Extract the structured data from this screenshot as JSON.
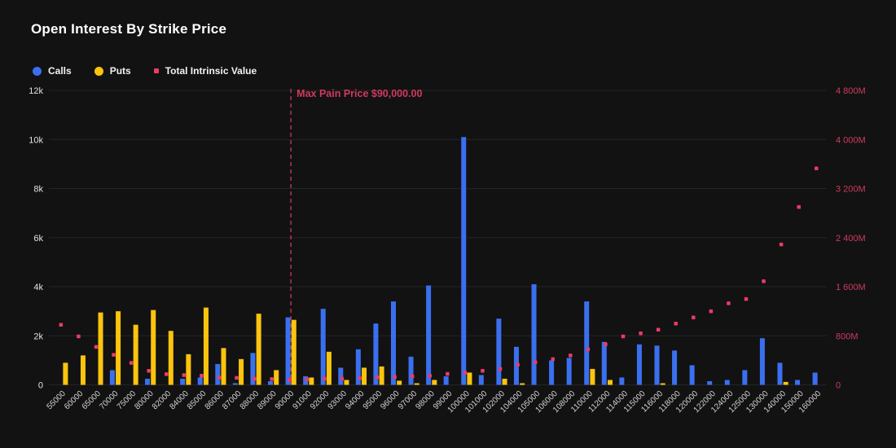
{
  "header": {
    "title": "Open Interest By Strike Price"
  },
  "legend": [
    {
      "label": "Calls",
      "color": "#3a70f0",
      "shape": "circle"
    },
    {
      "label": "Puts",
      "color": "#fcc40d",
      "shape": "circle"
    },
    {
      "label": "Total Intrinsic Value",
      "color": "#ee3a63",
      "shape": "square"
    }
  ],
  "annotation": {
    "max_pain_label": "Max Pain Price $90,000.00",
    "max_pain_strike": "90000"
  },
  "colors": {
    "background": "#121212",
    "grid": "#242428",
    "axis_text": "#e2e2e2",
    "x_text": "#cfcfcf",
    "calls": "#3a70f0",
    "puts": "#fcc40d",
    "intrinsic": "#ee3a63",
    "intrinsic_axis": "#cf3a5f",
    "max_pain_line": "#a93350"
  },
  "chart_data": {
    "type": "bar",
    "title": "Open Interest By Strike Price",
    "categories": [
      "55000",
      "60000",
      "65000",
      "70000",
      "75000",
      "80000",
      "82000",
      "84000",
      "85000",
      "86000",
      "87000",
      "88000",
      "89000",
      "90000",
      "91000",
      "92000",
      "93000",
      "94000",
      "95000",
      "96000",
      "97000",
      "98000",
      "99000",
      "100000",
      "101000",
      "102000",
      "104000",
      "105000",
      "106000",
      "108000",
      "110000",
      "112000",
      "114000",
      "115000",
      "116000",
      "118000",
      "120000",
      "122000",
      "124000",
      "125000",
      "130000",
      "140000",
      "150000",
      "160000"
    ],
    "series": [
      {
        "name": "Calls",
        "type": "bar",
        "axis": "left",
        "values": [
          0,
          0,
          0,
          600,
          0,
          250,
          0,
          250,
          300,
          850,
          70,
          1300,
          150,
          2750,
          350,
          3100,
          700,
          1450,
          2500,
          3400,
          1150,
          4050,
          350,
          10100,
          400,
          2700,
          1550,
          4100,
          1000,
          1100,
          3400,
          1750,
          300,
          1650,
          1600,
          1400,
          800,
          150,
          200,
          600,
          1900,
          900,
          200,
          500
        ]
      },
      {
        "name": "Puts",
        "type": "bar",
        "axis": "left",
        "values": [
          900,
          1200,
          2950,
          3000,
          2450,
          3050,
          2200,
          1250,
          3150,
          1500,
          1050,
          2900,
          600,
          2650,
          300,
          1350,
          200,
          700,
          750,
          170,
          60,
          200,
          0,
          500,
          0,
          250,
          60,
          0,
          0,
          0,
          650,
          200,
          0,
          0,
          60,
          0,
          0,
          0,
          0,
          0,
          0,
          120,
          0,
          0
        ]
      },
      {
        "name": "Total Intrinsic Value",
        "type": "scatter",
        "axis": "right",
        "values": [
          980,
          790,
          620,
          490,
          360,
          230,
          175,
          160,
          150,
          120,
          115,
          100,
          95,
          80,
          90,
          100,
          100,
          110,
          125,
          130,
          140,
          150,
          180,
          200,
          230,
          260,
          330,
          370,
          420,
          480,
          580,
          660,
          790,
          840,
          900,
          1000,
          1100,
          1200,
          1330,
          1400,
          1690,
          2290,
          2900,
          3530
        ]
      }
    ],
    "left_axis": {
      "ticks": [
        "0",
        "2k",
        "4k",
        "6k",
        "8k",
        "10k",
        "12k"
      ],
      "max": 12000
    },
    "right_axis": {
      "ticks": [
        "0",
        "800M",
        "1 600M",
        "2 400M",
        "3 200M",
        "4 000M",
        "4 800M"
      ],
      "max": 4800
    },
    "max_pain_index": 13,
    "grid": true,
    "legend_position": "top-left"
  }
}
